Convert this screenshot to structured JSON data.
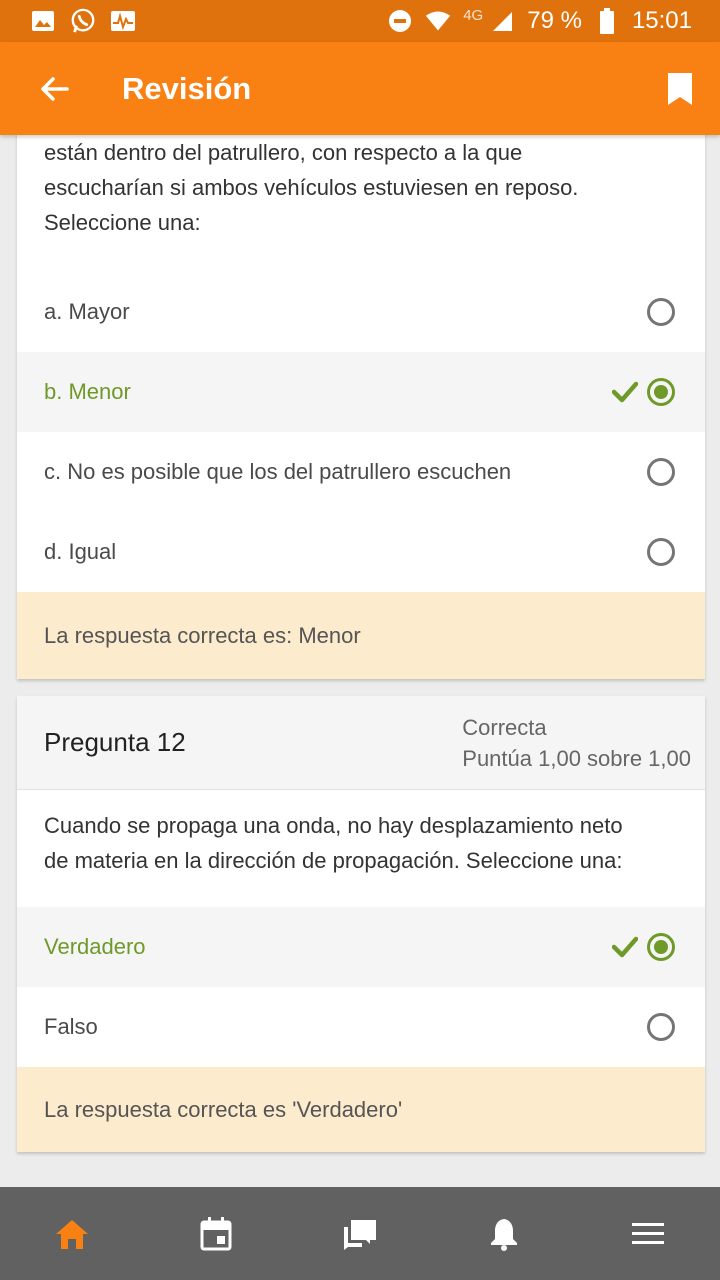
{
  "status_bar": {
    "network": "4G",
    "battery": "79 %",
    "time": "15:01"
  },
  "app_bar": {
    "title": "Revisión"
  },
  "question_11": {
    "text_lines": [
      "están dentro del patrullero, con respecto a la que",
      "escucharían si ambos vehículos estuviesen en reposo.",
      "Seleccione una:"
    ],
    "options": [
      {
        "label": "a. Mayor",
        "selected": false
      },
      {
        "label": "b. Menor",
        "selected": true
      },
      {
        "label": "c. No es posible que los del patrullero escuchen",
        "selected": false
      },
      {
        "label": "d. Igual",
        "selected": false
      }
    ],
    "feedback": "La respuesta correcta es: Menor"
  },
  "question_12": {
    "title": "Pregunta 12",
    "state": "Correcta",
    "grade": "Puntúa 1,00 sobre 1,00",
    "text_lines": [
      "Cuando se propaga una onda, no hay desplazamiento neto",
      "de materia en la dirección de propagación. Seleccione una:"
    ],
    "options": [
      {
        "label": "Verdadero",
        "selected": true
      },
      {
        "label": "Falso",
        "selected": false
      }
    ],
    "feedback": "La respuesta correcta es 'Verdadero'"
  },
  "bottom_nav": {
    "items": [
      "home-icon",
      "calendar-icon",
      "messages-icon",
      "bell-icon",
      "menu-icon"
    ],
    "active_color": "#f98012",
    "inactive_color": "#ffffff"
  },
  "colors": {
    "accent": "#f98012",
    "correct": "#6f9a2a",
    "feedback_bg": "#fdebcd"
  }
}
